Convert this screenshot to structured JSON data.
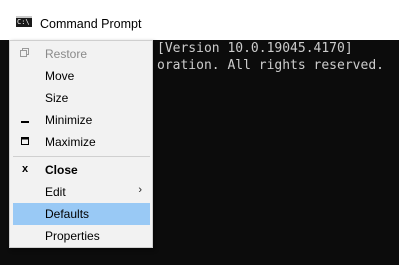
{
  "window": {
    "icon_text": "C:\\",
    "title": "Command Prompt"
  },
  "console": {
    "lines": [
      "[Version 10.0.19045.4170]",
      "oration. All rights reserved."
    ]
  },
  "menu": {
    "items": [
      {
        "label": "Restore",
        "icon": "restore-icon",
        "disabled": true
      },
      {
        "label": "Move"
      },
      {
        "label": "Size"
      },
      {
        "label": "Minimize",
        "icon": "minimize-icon"
      },
      {
        "label": "Maximize",
        "icon": "maximize-icon"
      },
      {
        "label": "Close",
        "icon": "close-icon",
        "bold": true
      },
      {
        "label": "Edit",
        "icon": "chevron-right-icon",
        "submenu": true
      },
      {
        "label": "Defaults",
        "highlighted": true
      },
      {
        "label": "Properties"
      }
    ]
  },
  "colors": {
    "console_bg": "#0c0c0c",
    "console_text": "#cccccc",
    "menu_bg": "#f2f2f2",
    "highlight": "#99c9f5",
    "disabled_text": "#8a8a8a"
  }
}
